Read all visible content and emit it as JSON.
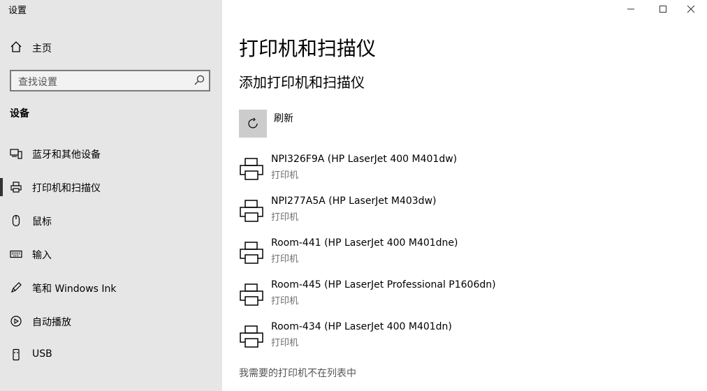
{
  "window": {
    "title": "设置",
    "controls": [
      "minimize",
      "maximize",
      "close"
    ]
  },
  "sidebar": {
    "home_label": "主页",
    "search_placeholder": "查找设置",
    "section_title": "设备",
    "items": [
      {
        "label": "蓝牙和其他设备",
        "icon": "bluetooth-devices-icon",
        "active": false
      },
      {
        "label": "打印机和扫描仪",
        "icon": "printer-icon",
        "active": true
      },
      {
        "label": "鼠标",
        "icon": "mouse-icon",
        "active": false
      },
      {
        "label": "输入",
        "icon": "keyboard-icon",
        "active": false
      },
      {
        "label": "笔和 Windows Ink",
        "icon": "pen-icon",
        "active": false
      },
      {
        "label": "自动播放",
        "icon": "autoplay-icon",
        "active": false
      },
      {
        "label": "USB",
        "icon": "usb-icon",
        "active": false
      }
    ]
  },
  "main": {
    "title": "打印机和扫描仪",
    "subtitle": "添加打印机和扫描仪",
    "refresh_label": "刷新",
    "printers": [
      {
        "name": "NPI326F9A (HP LaserJet 400 M401dw)",
        "type": "打印机"
      },
      {
        "name": "NPI277A5A (HP LaserJet M403dw)",
        "type": "打印机"
      },
      {
        "name": "Room-441 (HP LaserJet 400 M401dne)",
        "type": "打印机"
      },
      {
        "name": "Room-445 (HP LaserJet Professional P1606dn)",
        "type": "打印机"
      },
      {
        "name": "Room-434 (HP LaserJet 400 M401dn)",
        "type": "打印机"
      }
    ],
    "not_listed_link": "我需要的打印机不在列表中"
  }
}
